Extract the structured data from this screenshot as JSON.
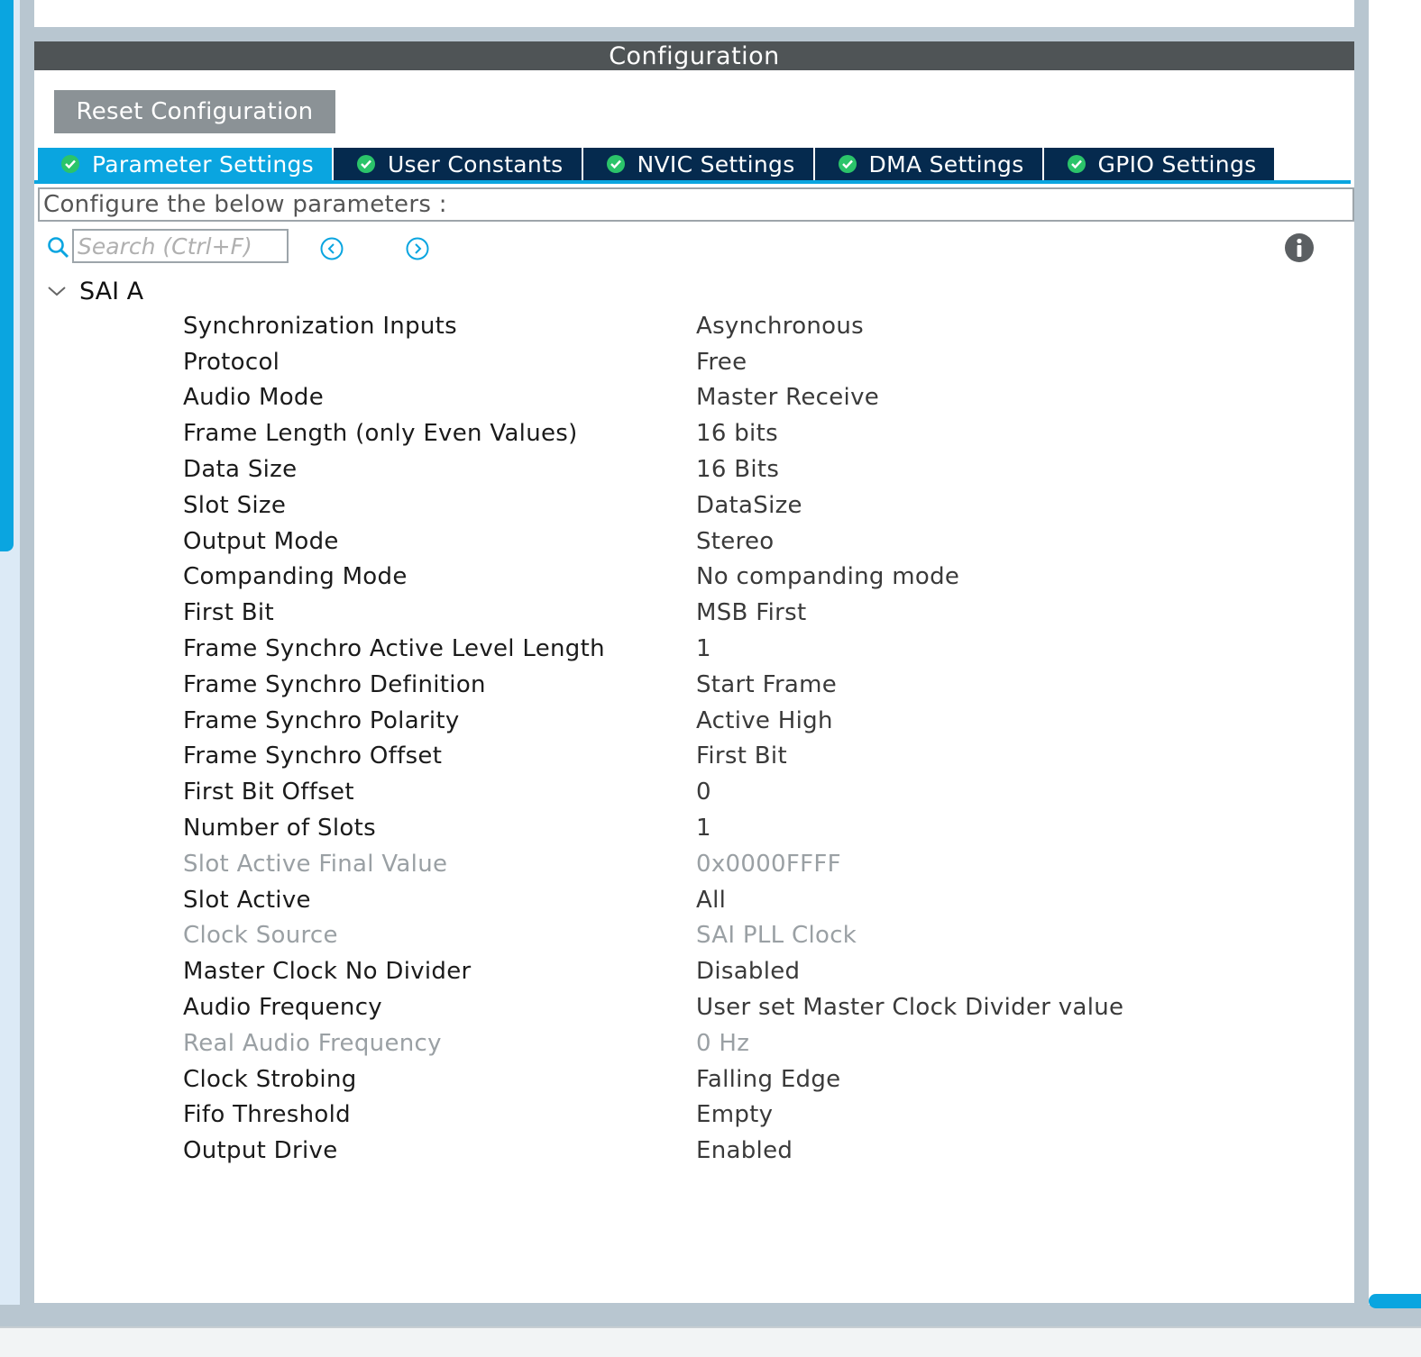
{
  "header": {
    "title": "Configuration"
  },
  "toolbar": {
    "reset_label": "Reset Configuration"
  },
  "tabs": [
    {
      "label": "Parameter Settings",
      "active": true
    },
    {
      "label": "User Constants",
      "active": false
    },
    {
      "label": "NVIC Settings",
      "active": false
    },
    {
      "label": "DMA Settings",
      "active": false
    },
    {
      "label": "GPIO Settings",
      "active": false
    }
  ],
  "instructions": "Configure the below parameters :",
  "search": {
    "placeholder": "Search (Ctrl+F)",
    "value": ""
  },
  "icons": {
    "search": "search-icon",
    "prev": "chevron-left-circle-icon",
    "next": "chevron-right-circle-icon",
    "info": "info-icon",
    "group_toggle": "chevron-down-icon",
    "tab_status": "check-circle-icon"
  },
  "colors": {
    "accent": "#0aa5e0",
    "tab_inactive": "#052a4e",
    "header": "#4f5456",
    "check": "#2bc46a",
    "disabled_text": "#9aa0a4"
  },
  "group": {
    "name": "SAI A",
    "params": [
      {
        "name": "Synchronization Inputs",
        "value": "Asynchronous",
        "disabled": false
      },
      {
        "name": "Protocol",
        "value": "Free",
        "disabled": false
      },
      {
        "name": "Audio Mode",
        "value": "Master Receive",
        "disabled": false
      },
      {
        "name": "Frame Length (only Even Values)",
        "value": "16 bits",
        "disabled": false
      },
      {
        "name": "Data Size",
        "value": "16 Bits",
        "disabled": false
      },
      {
        "name": "Slot Size",
        "value": "DataSize",
        "disabled": false
      },
      {
        "name": "Output Mode",
        "value": "Stereo",
        "disabled": false
      },
      {
        "name": "Companding Mode",
        "value": "No companding mode",
        "disabled": false
      },
      {
        "name": "First Bit",
        "value": "MSB First",
        "disabled": false
      },
      {
        "name": "Frame Synchro Active Level Length",
        "value": "1",
        "disabled": false
      },
      {
        "name": "Frame Synchro Definition",
        "value": "Start Frame",
        "disabled": false
      },
      {
        "name": "Frame Synchro Polarity",
        "value": "Active High",
        "disabled": false
      },
      {
        "name": "Frame Synchro Offset",
        "value": "First Bit",
        "disabled": false
      },
      {
        "name": "First Bit Offset",
        "value": "0",
        "disabled": false
      },
      {
        "name": "Number of Slots",
        "value": "1",
        "disabled": false
      },
      {
        "name": "Slot Active Final Value",
        "value": "0x0000FFFF",
        "disabled": true
      },
      {
        "name": "Slot Active",
        "value": "All",
        "disabled": false
      },
      {
        "name": "Clock Source",
        "value": "SAI PLL Clock",
        "disabled": true
      },
      {
        "name": "Master Clock No Divider",
        "value": "Disabled",
        "disabled": false
      },
      {
        "name": "Audio Frequency",
        "value": "User set Master Clock Divider value",
        "disabled": false
      },
      {
        "name": "Real Audio Frequency",
        "value": "0 Hz",
        "disabled": true
      },
      {
        "name": "Clock Strobing",
        "value": "Falling Edge",
        "disabled": false
      },
      {
        "name": "Fifo Threshold",
        "value": "Empty",
        "disabled": false
      },
      {
        "name": "Output Drive",
        "value": "Enabled",
        "disabled": false
      }
    ]
  }
}
